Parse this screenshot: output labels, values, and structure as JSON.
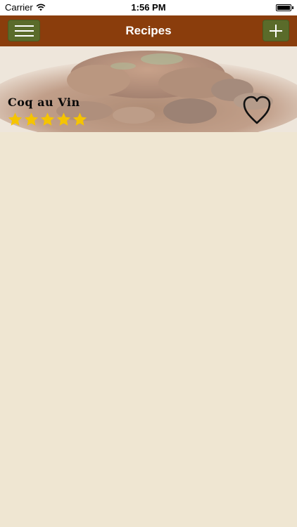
{
  "status_bar": {
    "carrier": "Carrier",
    "time": "1:56 PM",
    "wifi_icon": "wifi-icon",
    "battery_icon": "battery-icon"
  },
  "nav": {
    "title": "Recipes",
    "menu_icon": "hamburger-menu-icon",
    "add_icon": "plus-icon"
  },
  "recipes": [
    {
      "name": "Coq au Vin",
      "rating": 5,
      "rating_max": 5,
      "favorite_icon": "heart-outline-icon"
    }
  ],
  "colors": {
    "nav_bg": "#8a3d0c",
    "button_bg": "#5a6b2a",
    "page_bg": "#efe6d2",
    "star": "#f5c400"
  }
}
